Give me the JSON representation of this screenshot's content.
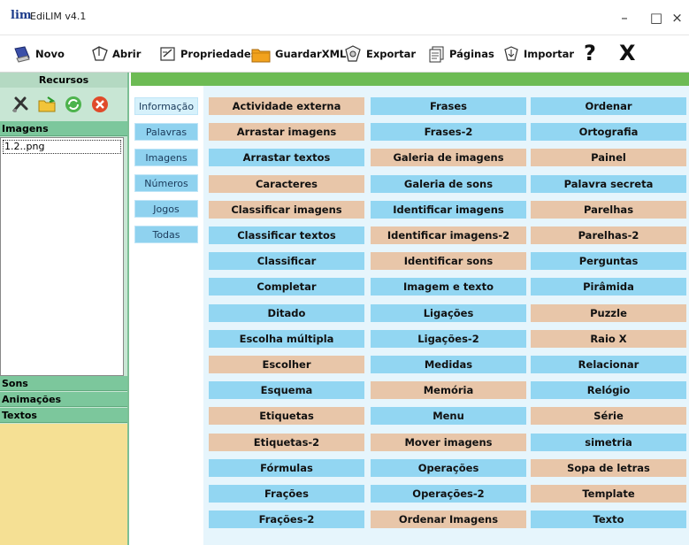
{
  "window": {
    "logo": "lim",
    "title": "EdiLIM v4.1",
    "minimize": "–",
    "maximize": "□",
    "close": "×"
  },
  "toolbar": {
    "novo": "Novo",
    "abrir": "Abrir",
    "propriedades": "Propriedades",
    "guardar_xml": "GuardarXML",
    "exportar": "Exportar",
    "paginas": "Páginas",
    "importar": "Importar",
    "help": "?",
    "exit": "X"
  },
  "sidebar": {
    "recursos": "Recursos",
    "sections": {
      "imagens": "Imagens",
      "sons": "Sons",
      "animacoes": "Animações",
      "textos": "Textos"
    },
    "files": [
      "1.2..png"
    ]
  },
  "categories": [
    {
      "label": "Informação",
      "active": true
    },
    {
      "label": "Palavras",
      "active": false
    },
    {
      "label": "Imagens",
      "active": false
    },
    {
      "label": "Números",
      "active": false
    },
    {
      "label": "Jogos",
      "active": false
    },
    {
      "label": "Todas",
      "active": false
    }
  ],
  "colors": {
    "blue": "#92d6f2",
    "tan": "#e8c6a9"
  },
  "activities": {
    "col1": [
      {
        "label": "Actividade externa",
        "color": "tan"
      },
      {
        "label": "Arrastar imagens",
        "color": "tan"
      },
      {
        "label": "Arrastar textos",
        "color": "blue"
      },
      {
        "label": "Caracteres",
        "color": "tan"
      },
      {
        "label": "Classificar imagens",
        "color": "tan"
      },
      {
        "label": "Classificar textos",
        "color": "blue"
      },
      {
        "label": "Classificar",
        "color": "blue"
      },
      {
        "label": "Completar",
        "color": "blue"
      },
      {
        "label": "Ditado",
        "color": "blue"
      },
      {
        "label": "Escolha múltipla",
        "color": "blue"
      },
      {
        "label": "Escolher",
        "color": "tan"
      },
      {
        "label": "Esquema",
        "color": "blue"
      },
      {
        "label": "Etiquetas",
        "color": "tan"
      },
      {
        "label": "Etiquetas-2",
        "color": "tan"
      },
      {
        "label": "Fórmulas",
        "color": "blue"
      },
      {
        "label": "Frações",
        "color": "blue"
      },
      {
        "label": "Frações-2",
        "color": "blue"
      }
    ],
    "col2": [
      {
        "label": "Frases",
        "color": "blue"
      },
      {
        "label": "Frases-2",
        "color": "blue"
      },
      {
        "label": "Galeria de imagens",
        "color": "tan"
      },
      {
        "label": "Galeria de sons",
        "color": "blue"
      },
      {
        "label": "Identificar imagens",
        "color": "blue"
      },
      {
        "label": "Identificar imagens-2",
        "color": "tan"
      },
      {
        "label": "Identificar sons",
        "color": "tan"
      },
      {
        "label": "Imagem e texto",
        "color": "blue"
      },
      {
        "label": "Ligações",
        "color": "blue"
      },
      {
        "label": "Ligações-2",
        "color": "blue"
      },
      {
        "label": "Medidas",
        "color": "blue"
      },
      {
        "label": "Memória",
        "color": "tan"
      },
      {
        "label": "Menu",
        "color": "blue"
      },
      {
        "label": "Mover imagens",
        "color": "tan"
      },
      {
        "label": "Operações",
        "color": "blue"
      },
      {
        "label": "Operações-2",
        "color": "blue"
      },
      {
        "label": "Ordenar Imagens",
        "color": "tan"
      }
    ],
    "col3": [
      {
        "label": "Ordenar",
        "color": "blue"
      },
      {
        "label": "Ortografia",
        "color": "blue"
      },
      {
        "label": "Painel",
        "color": "tan"
      },
      {
        "label": "Palavra secreta",
        "color": "blue"
      },
      {
        "label": "Parelhas",
        "color": "tan"
      },
      {
        "label": "Parelhas-2",
        "color": "tan"
      },
      {
        "label": "Perguntas",
        "color": "blue"
      },
      {
        "label": "Pirâmida",
        "color": "blue"
      },
      {
        "label": "Puzzle",
        "color": "tan"
      },
      {
        "label": "Raio X",
        "color": "tan"
      },
      {
        "label": "Relacionar",
        "color": "blue"
      },
      {
        "label": "Relógio",
        "color": "blue"
      },
      {
        "label": "Série",
        "color": "tan"
      },
      {
        "label": "simetria",
        "color": "blue"
      },
      {
        "label": "Sopa de letras",
        "color": "tan"
      },
      {
        "label": "Template",
        "color": "tan"
      },
      {
        "label": "Texto",
        "color": "blue"
      }
    ]
  }
}
